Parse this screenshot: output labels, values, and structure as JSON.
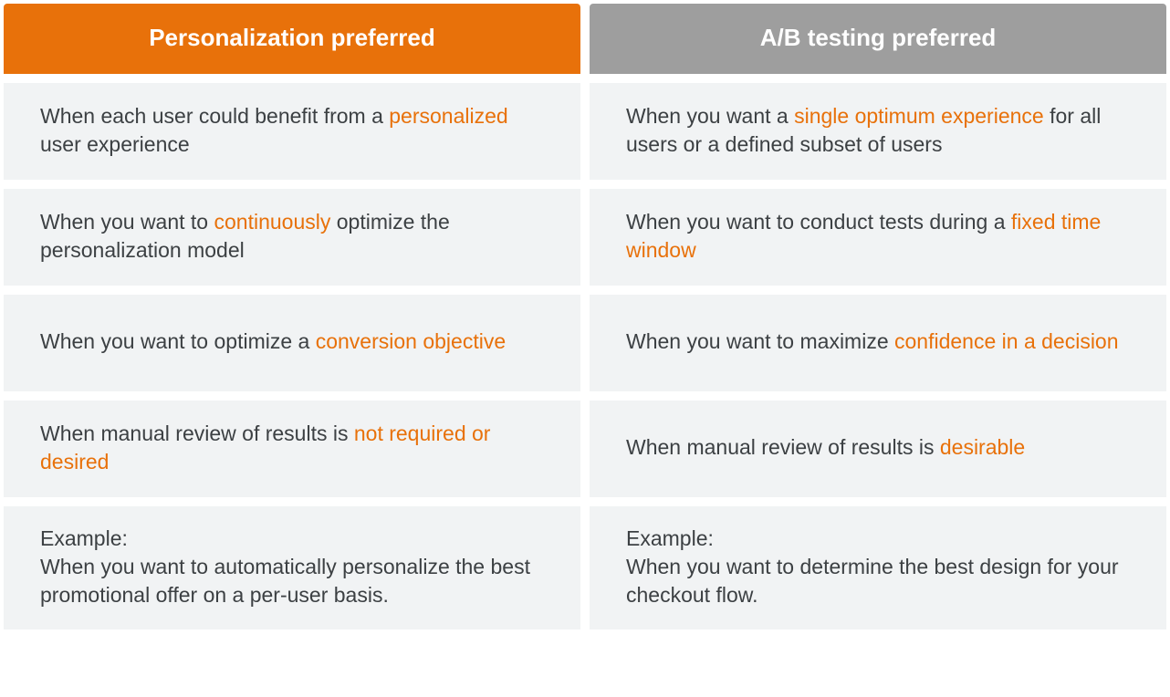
{
  "headers": {
    "left": "Personalization preferred",
    "right": "A/B testing preferred"
  },
  "rows": [
    {
      "left": {
        "segments": [
          {
            "t": "When each user could benefit from a "
          },
          {
            "t": "personalized",
            "hl": true
          },
          {
            "t": "\nuser experience"
          }
        ]
      },
      "right": {
        "segments": [
          {
            "t": "When you want a "
          },
          {
            "t": "single optimum experience",
            "hl": true
          },
          {
            "t": " for all users or a defined subset of users"
          }
        ]
      }
    },
    {
      "left": {
        "segments": [
          {
            "t": "When you want to "
          },
          {
            "t": "continuously",
            "hl": true
          },
          {
            "t": " optimize the personalization model"
          }
        ]
      },
      "right": {
        "segments": [
          {
            "t": "When you want to conduct tests during a "
          },
          {
            "t": "fixed time window",
            "hl": true
          }
        ]
      }
    },
    {
      "left": {
        "segments": [
          {
            "t": "When you want to optimize a "
          },
          {
            "t": "conversion objective",
            "hl": true
          }
        ]
      },
      "right": {
        "segments": [
          {
            "t": "When you want to maximize "
          },
          {
            "t": "confidence in a decision",
            "hl": true
          }
        ]
      }
    },
    {
      "left": {
        "segments": [
          {
            "t": "When manual review of results is "
          },
          {
            "t": "not required or desired",
            "hl": true
          }
        ]
      },
      "right": {
        "segments": [
          {
            "t": "When manual review of results is "
          },
          {
            "t": "desirable",
            "hl": true
          }
        ]
      }
    },
    {
      "left": {
        "segments": [
          {
            "t": "Example:\nWhen you want to automatically personalize the best promotional offer on a per-user basis."
          }
        ]
      },
      "right": {
        "segments": [
          {
            "t": "Example:\nWhen you want to determine the best design for your checkout flow."
          }
        ]
      }
    }
  ]
}
